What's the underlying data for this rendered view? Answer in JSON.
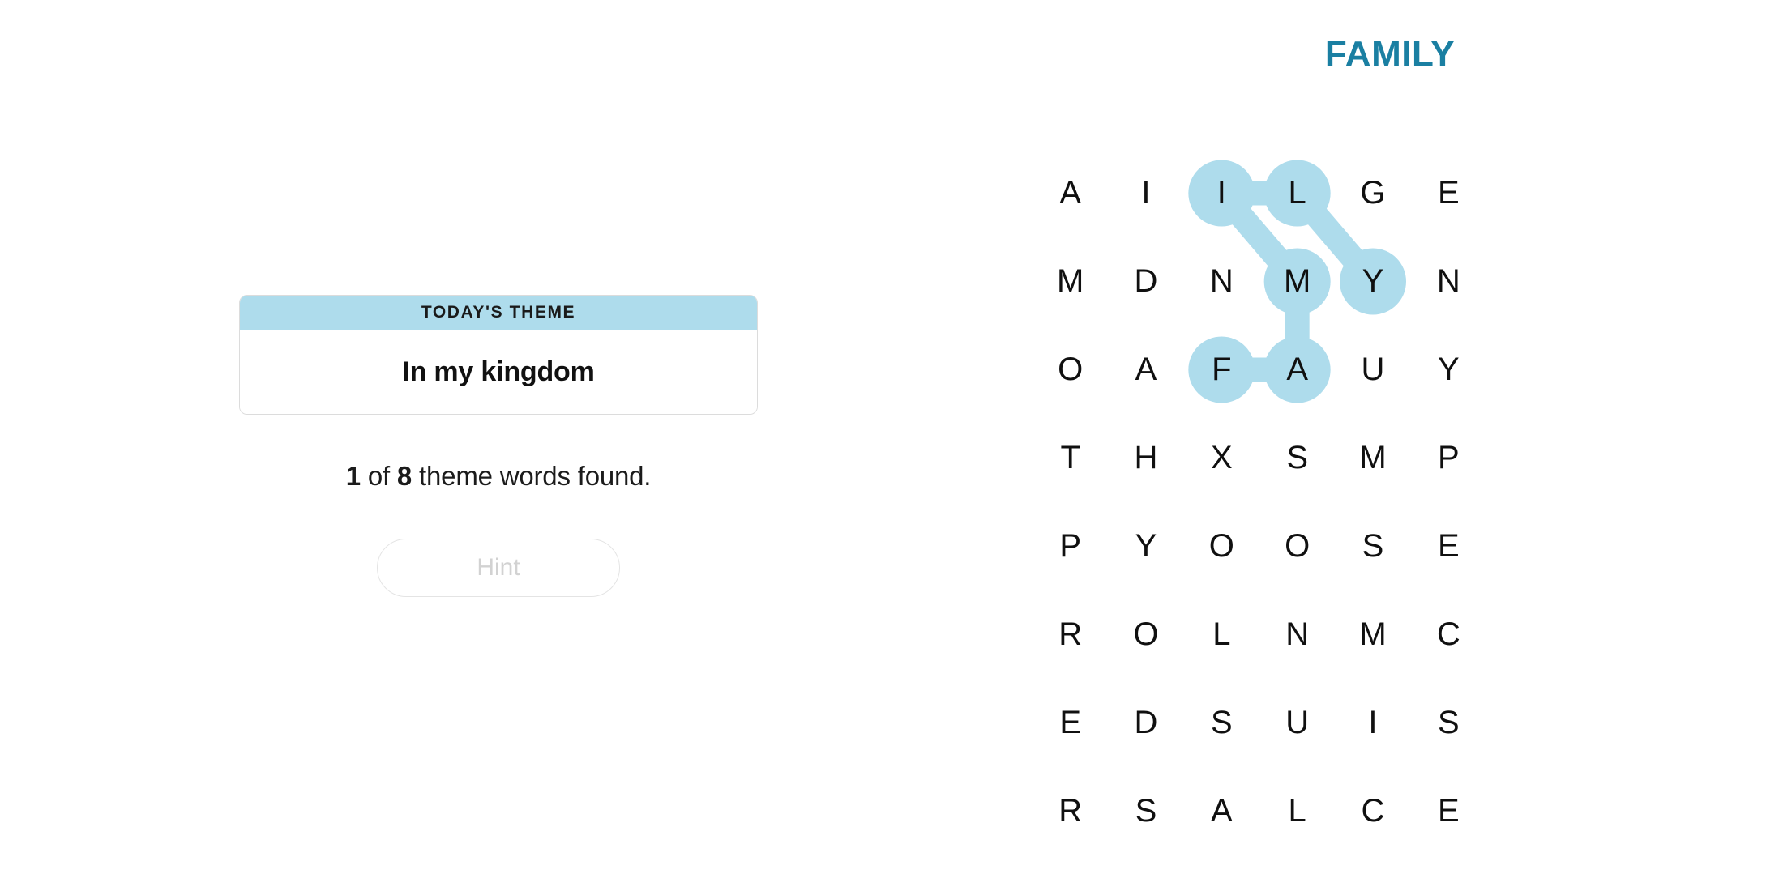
{
  "puzzle": {
    "title": "FAMILY",
    "title_color": "#1a7fa2",
    "highlight_color": "#aedcec"
  },
  "theme_card": {
    "header_label": "TODAY'S THEME",
    "theme_text": "In my kingdom",
    "header_bg": "#aedcec"
  },
  "progress": {
    "found_count": "1",
    "of_label": "of",
    "total_count": "8",
    "suffix": "theme words found."
  },
  "hint": {
    "label": "Hint"
  },
  "grid": {
    "rows": 8,
    "cols": 6,
    "letters": [
      [
        "A",
        "I",
        "I",
        "L",
        "G",
        "E"
      ],
      [
        "M",
        "D",
        "N",
        "M",
        "Y",
        "N"
      ],
      [
        "O",
        "A",
        "F",
        "A",
        "U",
        "Y"
      ],
      [
        "T",
        "H",
        "X",
        "S",
        "M",
        "P"
      ],
      [
        "P",
        "Y",
        "O",
        "O",
        "S",
        "E"
      ],
      [
        "R",
        "O",
        "L",
        "N",
        "M",
        "C"
      ],
      [
        "E",
        "D",
        "S",
        "U",
        "I",
        "S"
      ],
      [
        "R",
        "S",
        "A",
        "L",
        "C",
        "E"
      ]
    ],
    "found_words": [
      {
        "word": "FAMILY",
        "path": [
          {
            "row": 2,
            "col": 2,
            "letter": "F"
          },
          {
            "row": 2,
            "col": 3,
            "letter": "A"
          },
          {
            "row": 1,
            "col": 3,
            "letter": "M"
          },
          {
            "row": 0,
            "col": 2,
            "letter": "I"
          },
          {
            "row": 0,
            "col": 3,
            "letter": "L"
          },
          {
            "row": 1,
            "col": 4,
            "letter": "Y"
          }
        ]
      }
    ]
  }
}
